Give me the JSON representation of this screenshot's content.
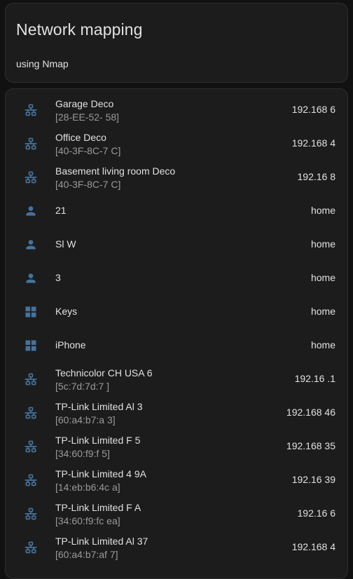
{
  "header": {
    "title": "Network mapping",
    "subtitle": "using Nmap"
  },
  "colors": {
    "icon": "#44739e",
    "text": "#e1e1e1",
    "secondary": "#9a9a9a",
    "card": "#1c1c1c",
    "background": "#111111"
  },
  "entities": [
    {
      "icon": "lan-icon",
      "name": "Garage Deco",
      "mac": "[28-EE-52-    58]",
      "state": "192.168    6"
    },
    {
      "icon": "lan-icon",
      "name": "Office Deco",
      "mac": "[40-3F-8C-7    C]",
      "state": "192.168    4"
    },
    {
      "icon": "lan-icon",
      "name": "Basement living room Deco",
      "mac": "[40-3F-8C-7    C]",
      "state": "192.16    8"
    },
    {
      "icon": "account-icon",
      "name": "    21",
      "mac": "",
      "state": "home"
    },
    {
      "icon": "account-icon",
      "name": "Sl    W",
      "mac": "",
      "state": "home"
    },
    {
      "icon": "account-icon",
      "name": "    3",
      "mac": "",
      "state": "home"
    },
    {
      "icon": "windows-icon",
      "name": "Keys",
      "mac": "",
      "state": "home"
    },
    {
      "icon": "windows-icon",
      "name": "iPhone",
      "mac": "",
      "state": "home"
    },
    {
      "icon": "lan-icon",
      "name": "Technicolor CH USA    6",
      "mac": "[5c:7d:7d:7    ]",
      "state": "192.16    .1"
    },
    {
      "icon": "lan-icon",
      "name": "TP-Link Limited Al    3",
      "mac": "[60:a4:b7:a    3]",
      "state": "192.168    46"
    },
    {
      "icon": "lan-icon",
      "name": "TP-Link Limited F    5",
      "mac": "[34:60:f9:f    5]",
      "state": "192.168    35"
    },
    {
      "icon": "lan-icon",
      "name": "TP-Link Limited 4    9A",
      "mac": "[14:eb:b6:4c    a]",
      "state": "192.16    39"
    },
    {
      "icon": "lan-icon",
      "name": "TP-Link Limited F    A",
      "mac": "[34:60:f9:fc    ea]",
      "state": "192.16    6"
    },
    {
      "icon": "lan-icon",
      "name": "TP-Link Limited Al    37",
      "mac": "[60:a4:b7:af    7]",
      "state": "192.168    4"
    }
  ]
}
